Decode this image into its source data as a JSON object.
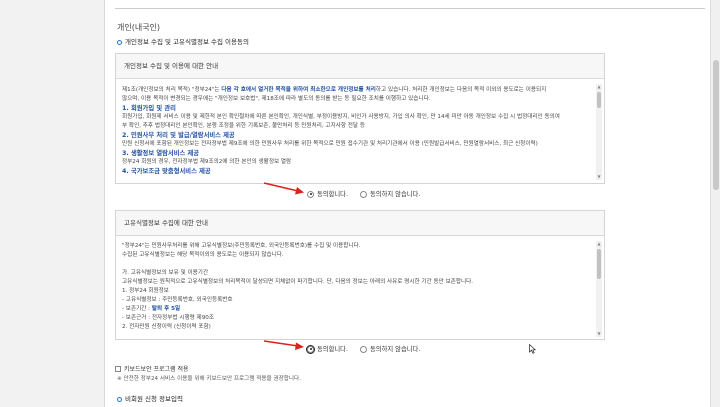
{
  "page": {
    "title": "개인(내국인)",
    "subtitle": "개인정보 수집 및 고유식별정보 수집 이용동의"
  },
  "panel1": {
    "header": "개인정보 수집 및 이용에 대한 안내",
    "lines": [
      {
        "pre": "제1조(개인정보의 처리 목적) \"정부24\"는 ",
        "em": "다음 각 호에서 열거한 목적을 위하여 최소한으로 개인정보를 처리",
        "post": "하고 있습니다. 처리한 개인정보는 다음의 목적 이외의 용도로는 이용되지"
      },
      {
        "pre": "않으며, 이용 목적이 변경되는 경우에는 \"개인정보 보호법\", 제18조에 따라 별도의 동의를 받는 등 필요한 조치를 이행하고 있습니다.",
        "em": "",
        "post": ""
      }
    ],
    "items": [
      {
        "title": "1. 회원가입 및 관리",
        "desc": "회원가입, 회원제 서비스 이용 및 제한적 본인 확인절차에 따른 본인확인, 개인식별, 부정이용방지, 비인가 사용방지, 가입 의사 확인, 만 14세 미만 아동 개인정보 수집 시 법정대리인 동의여",
        "desc2": "부 확인, 추후 법정대리인 본인확인, 분쟁 조정을 위한 기록보존, 불만처리 등 민원처리, 고지사항 전달 등"
      },
      {
        "title": "2. 민원사무 처리 및 발급/열람서비스 제공",
        "desc": "민원 신청서에 포함된 개인정보는 전자정부법 제9조에 의한 민원사무 처리를 위한 목적으로 민원 접수기관 및 처리기관에서 이용 (민원발급서비스, 민원열람서비스, 최근 신청이력)",
        "desc2": ""
      },
      {
        "title": "3. 생활정보 열람서비스 제공",
        "desc": "정부24 회원의 경우, 전자정부법 제9조의2에 의한 본인의 생활정보 열람",
        "desc2": ""
      },
      {
        "title": "4. 국가보조금 맞춤형서비스 제공",
        "desc": "",
        "desc2": ""
      }
    ],
    "agree": "동의합니다.",
    "disagree": "동의하지 않습니다."
  },
  "panel2": {
    "header": "고유식별정보 수집에 대한 안내",
    "lines": [
      "\"정부24\"는 민원사무처리를 위해 고유식별정보(주민등록번호, 외국인등록번호)를 수집 및 이용합니다.",
      "수집된 고유식별정보는 해당 목적이외의 용도로는 이용되지 않습니다.",
      "",
      "가. 고유식별정보의 보유 및 이용기간",
      "  고유식별정보는 원칙적으로 고유식별정보의 처리목적이 달성되면 지체없이 파기합니다. 단, 다음의 정보는 아래의 사유로 명시한 기간 동안 보존합니다.",
      "  1. 정부24 회원정보",
      "    - 고유식별정보 : 주민등록번호, 외국인등록번호"
    ],
    "retention_pre": "    - 보존기간 : ",
    "retention_em": "탈퇴 후 5일",
    "lines_after": [
      "    - 보존근거 : 전자정부법 시행령 제90조",
      "  2. 전자민원 신청이력 (신청이력 포함)"
    ],
    "agree": "동의합니다.",
    "disagree": "동의하지 않습니다."
  },
  "keyboard": {
    "label": "키보드보안 프로그램 적용",
    "note": "※ 안전한 정부24 서비스 이용을 위해 키보드보안 프로그램 적용을 권장합니다."
  },
  "next_section": {
    "title": "비회원 신청 정보입력"
  },
  "colors": {
    "accent_blue": "#1f4f9f",
    "arrow_red": "#e0201c"
  }
}
